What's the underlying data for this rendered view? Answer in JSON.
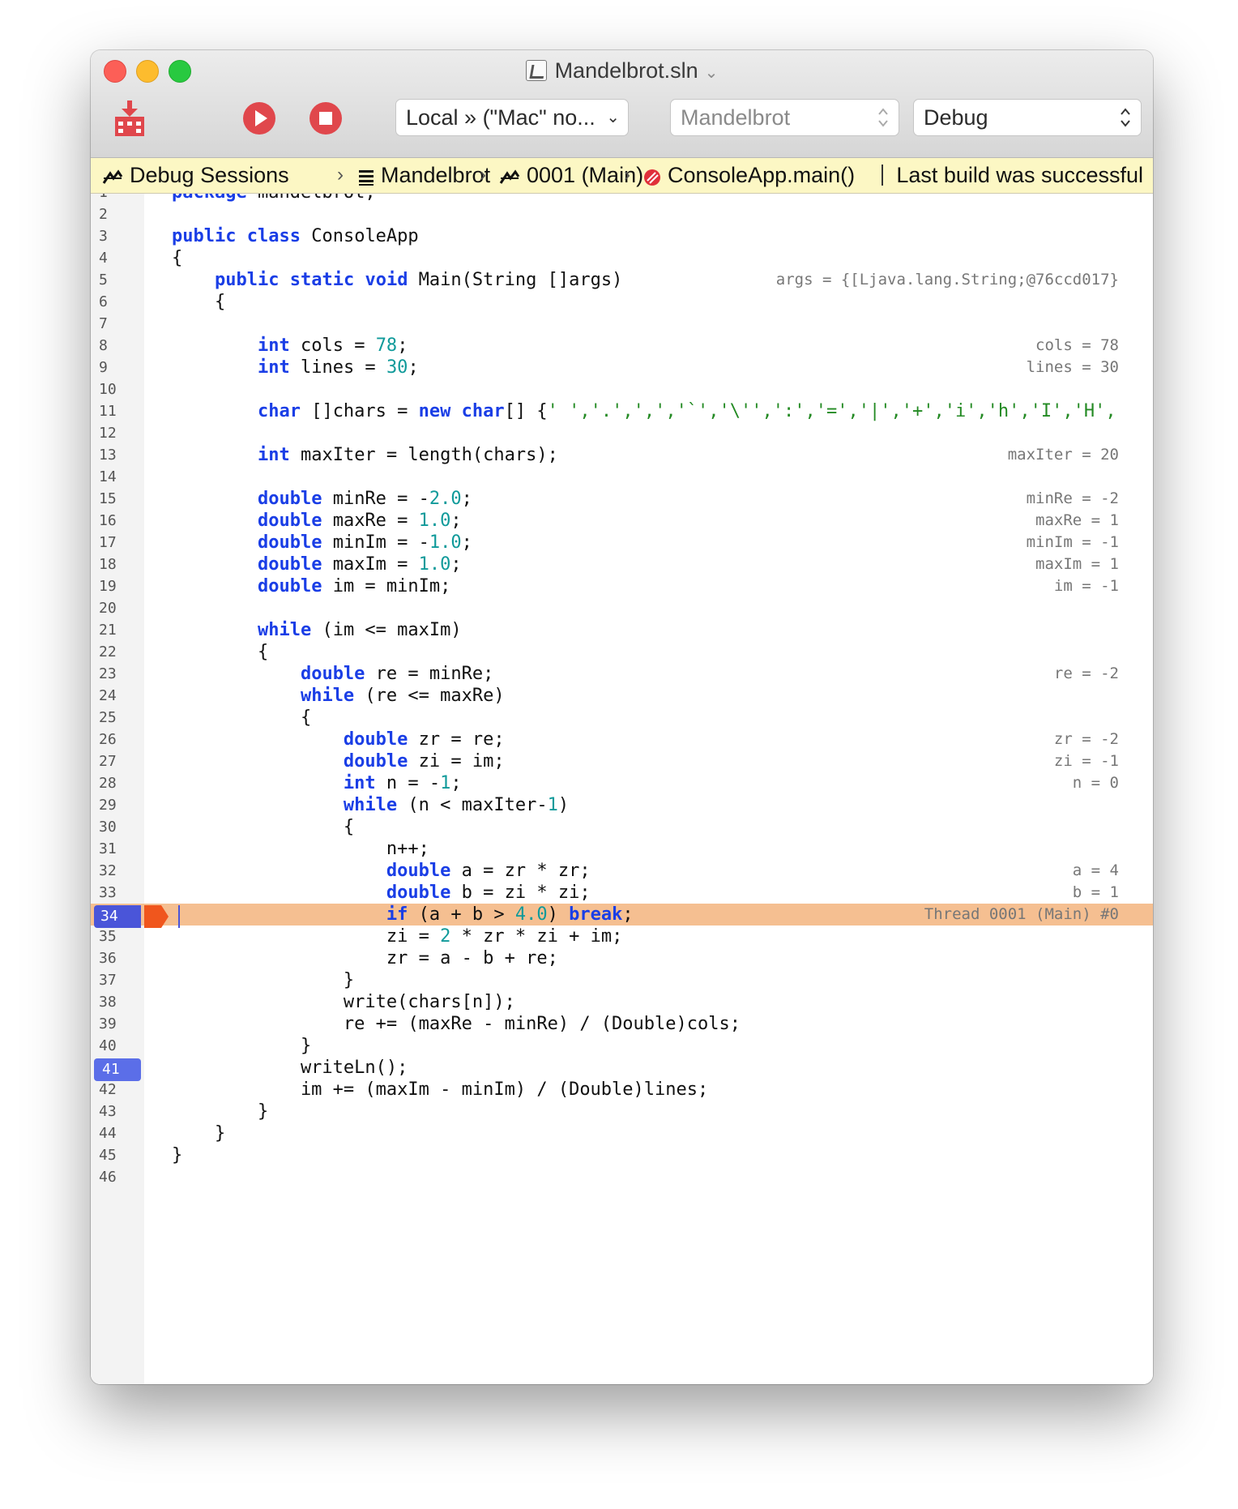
{
  "window": {
    "title": "Mandelbrot.sln",
    "title_chevron": "⌄"
  },
  "toolbar": {
    "target_label": "Local » (\"Mac\" no...",
    "project_label": "Mandelbrot",
    "config_label": "Debug",
    "icons": [
      "build-icon",
      "run-icon",
      "stop-icon"
    ]
  },
  "status": {
    "crumbs": [
      "Debug Sessions",
      "Mandelbrot",
      "0001 (Main)",
      "ConsoleApp.main()"
    ],
    "message": "Last build was successful"
  },
  "colors": {
    "keyword": "#1a3ee6",
    "number": "#0f9a9a",
    "string": "#238a23",
    "current_line": "#f5bf91",
    "breakpoint": "#5b6ee8",
    "status_bar": "#fcf7c4"
  },
  "editor": {
    "current_line": 34,
    "breakpoint_line": 41,
    "lines": [
      {
        "n": "1",
        "code": [
          [
            "kw",
            "package"
          ],
          [
            "t",
            " mandelbrot;"
          ]
        ],
        "hint": ""
      },
      {
        "n": "2",
        "code": [],
        "hint": ""
      },
      {
        "n": "3",
        "code": [
          [
            "kw",
            "public"
          ],
          [
            "t",
            " "
          ],
          [
            "kw",
            "class"
          ],
          [
            "t",
            " ConsoleApp"
          ]
        ],
        "hint": ""
      },
      {
        "n": "4",
        "code": [
          [
            "t",
            "{"
          ]
        ],
        "hint": ""
      },
      {
        "n": "5",
        "code": [
          [
            "t",
            "    "
          ],
          [
            "kw",
            "public"
          ],
          [
            "t",
            " "
          ],
          [
            "kw",
            "static"
          ],
          [
            "t",
            " "
          ],
          [
            "kw",
            "void"
          ],
          [
            "t",
            " Main(String []args)"
          ]
        ],
        "hint": "args = {[Ljava.lang.String;@76ccd017}"
      },
      {
        "n": "6",
        "code": [
          [
            "t",
            "    {"
          ]
        ],
        "hint": ""
      },
      {
        "n": "7",
        "code": [],
        "hint": ""
      },
      {
        "n": "8",
        "code": [
          [
            "t",
            "        "
          ],
          [
            "kw",
            "int"
          ],
          [
            "t",
            " cols = "
          ],
          [
            "num",
            "78"
          ],
          [
            "t",
            ";"
          ]
        ],
        "hint": "cols = 78"
      },
      {
        "n": "9",
        "code": [
          [
            "t",
            "        "
          ],
          [
            "kw",
            "int"
          ],
          [
            "t",
            " lines = "
          ],
          [
            "num",
            "30"
          ],
          [
            "t",
            ";"
          ]
        ],
        "hint": "lines = 30"
      },
      {
        "n": "10",
        "code": [],
        "hint": ""
      },
      {
        "n": "11",
        "code": [
          [
            "t",
            "        "
          ],
          [
            "kw",
            "char"
          ],
          [
            "t",
            " []chars = "
          ],
          [
            "kw",
            "new"
          ],
          [
            "t",
            " "
          ],
          [
            "kw",
            "char"
          ],
          [
            "t",
            "[] {"
          ],
          [
            "str",
            "' ','.',',','`','\\'',':','=','|','+','i','h','I','H',"
          ]
        ],
        "hint": ""
      },
      {
        "n": "12",
        "code": [],
        "hint": ""
      },
      {
        "n": "13",
        "code": [
          [
            "t",
            "        "
          ],
          [
            "kw",
            "int"
          ],
          [
            "t",
            " maxIter = length(chars);"
          ]
        ],
        "hint": "maxIter = 20"
      },
      {
        "n": "14",
        "code": [],
        "hint": ""
      },
      {
        "n": "15",
        "code": [
          [
            "t",
            "        "
          ],
          [
            "kw",
            "double"
          ],
          [
            "t",
            " minRe = -"
          ],
          [
            "num",
            "2.0"
          ],
          [
            "t",
            ";"
          ]
        ],
        "hint": "minRe = -2"
      },
      {
        "n": "16",
        "code": [
          [
            "t",
            "        "
          ],
          [
            "kw",
            "double"
          ],
          [
            "t",
            " maxRe = "
          ],
          [
            "num",
            "1.0"
          ],
          [
            "t",
            ";"
          ]
        ],
        "hint": "maxRe = 1"
      },
      {
        "n": "17",
        "code": [
          [
            "t",
            "        "
          ],
          [
            "kw",
            "double"
          ],
          [
            "t",
            " minIm = -"
          ],
          [
            "num",
            "1.0"
          ],
          [
            "t",
            ";"
          ]
        ],
        "hint": "minIm = -1"
      },
      {
        "n": "18",
        "code": [
          [
            "t",
            "        "
          ],
          [
            "kw",
            "double"
          ],
          [
            "t",
            " maxIm = "
          ],
          [
            "num",
            "1.0"
          ],
          [
            "t",
            ";"
          ]
        ],
        "hint": "maxIm = 1"
      },
      {
        "n": "19",
        "code": [
          [
            "t",
            "        "
          ],
          [
            "kw",
            "double"
          ],
          [
            "t",
            " im = minIm;"
          ]
        ],
        "hint": "im = -1"
      },
      {
        "n": "20",
        "code": [],
        "hint": ""
      },
      {
        "n": "21",
        "code": [
          [
            "t",
            "        "
          ],
          [
            "kw",
            "while"
          ],
          [
            "t",
            " (im <= maxIm)"
          ]
        ],
        "hint": ""
      },
      {
        "n": "22",
        "code": [
          [
            "t",
            "        {"
          ]
        ],
        "hint": ""
      },
      {
        "n": "23",
        "code": [
          [
            "t",
            "            "
          ],
          [
            "kw",
            "double"
          ],
          [
            "t",
            " re = minRe;"
          ]
        ],
        "hint": "re = -2"
      },
      {
        "n": "24",
        "code": [
          [
            "t",
            "            "
          ],
          [
            "kw",
            "while"
          ],
          [
            "t",
            " (re <= maxRe)"
          ]
        ],
        "hint": ""
      },
      {
        "n": "25",
        "code": [
          [
            "t",
            "            {"
          ]
        ],
        "hint": ""
      },
      {
        "n": "26",
        "code": [
          [
            "t",
            "                "
          ],
          [
            "kw",
            "double"
          ],
          [
            "t",
            " zr = re;"
          ]
        ],
        "hint": "zr = -2"
      },
      {
        "n": "27",
        "code": [
          [
            "t",
            "                "
          ],
          [
            "kw",
            "double"
          ],
          [
            "t",
            " zi = im;"
          ]
        ],
        "hint": "zi = -1"
      },
      {
        "n": "28",
        "code": [
          [
            "t",
            "                "
          ],
          [
            "kw",
            "int"
          ],
          [
            "t",
            " n = -"
          ],
          [
            "num",
            "1"
          ],
          [
            "t",
            ";"
          ]
        ],
        "hint": "n = 0"
      },
      {
        "n": "29",
        "code": [
          [
            "t",
            "                "
          ],
          [
            "kw",
            "while"
          ],
          [
            "t",
            " (n < maxIter-"
          ],
          [
            "num",
            "1"
          ],
          [
            "t",
            ")"
          ]
        ],
        "hint": ""
      },
      {
        "n": "30",
        "code": [
          [
            "t",
            "                {"
          ]
        ],
        "hint": ""
      },
      {
        "n": "31",
        "code": [
          [
            "t",
            "                    n++;"
          ]
        ],
        "hint": ""
      },
      {
        "n": "32",
        "code": [
          [
            "t",
            "                    "
          ],
          [
            "kw",
            "double"
          ],
          [
            "t",
            " a = zr * zr;"
          ]
        ],
        "hint": "a = 4"
      },
      {
        "n": "33",
        "code": [
          [
            "t",
            "                    "
          ],
          [
            "kw",
            "double"
          ],
          [
            "t",
            " b = zi * zi;"
          ]
        ],
        "hint": "b = 1"
      },
      {
        "n": "34",
        "code": [
          [
            "t",
            "                    "
          ],
          [
            "kw",
            "if"
          ],
          [
            "t",
            " (a + b > "
          ],
          [
            "num",
            "4.0"
          ],
          [
            "t",
            ") "
          ],
          [
            "kw",
            "break"
          ],
          [
            "t",
            ";"
          ]
        ],
        "hint": "Thread 0001 (Main) #0"
      },
      {
        "n": "35",
        "code": [
          [
            "t",
            "                    zi = "
          ],
          [
            "num",
            "2"
          ],
          [
            "t",
            " * zr * zi + im;"
          ]
        ],
        "hint": ""
      },
      {
        "n": "36",
        "code": [
          [
            "t",
            "                    zr = a - b + re;"
          ]
        ],
        "hint": ""
      },
      {
        "n": "37",
        "code": [
          [
            "t",
            "                }"
          ]
        ],
        "hint": ""
      },
      {
        "n": "38",
        "code": [
          [
            "t",
            "                write(chars[n]);"
          ]
        ],
        "hint": ""
      },
      {
        "n": "39",
        "code": [
          [
            "t",
            "                re += (maxRe - minRe) / (Double)cols;"
          ]
        ],
        "hint": ""
      },
      {
        "n": "40",
        "code": [
          [
            "t",
            "            }"
          ]
        ],
        "hint": ""
      },
      {
        "n": "41",
        "code": [
          [
            "t",
            "            writeLn();"
          ]
        ],
        "hint": ""
      },
      {
        "n": "42",
        "code": [
          [
            "t",
            "            im += (maxIm - minIm) / (Double)lines;"
          ]
        ],
        "hint": ""
      },
      {
        "n": "43",
        "code": [
          [
            "t",
            "        }"
          ]
        ],
        "hint": ""
      },
      {
        "n": "44",
        "code": [
          [
            "t",
            "    }"
          ]
        ],
        "hint": ""
      },
      {
        "n": "45",
        "code": [
          [
            "t",
            "}"
          ]
        ],
        "hint": ""
      },
      {
        "n": "46",
        "code": [],
        "hint": ""
      }
    ]
  }
}
